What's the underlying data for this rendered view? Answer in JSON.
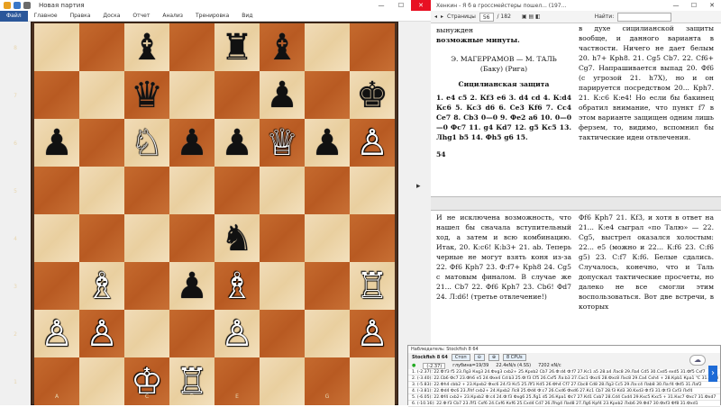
{
  "chess_app": {
    "title": "Новая партия",
    "menu": [
      "Файл",
      "Главное",
      "Правка",
      "Доска",
      "Отчет",
      "Анализ",
      "Тренировка",
      "Вид"
    ],
    "ranks": [
      "8",
      "7",
      "6",
      "5",
      "4",
      "3",
      "2",
      "1"
    ],
    "files": [
      "A",
      "B",
      "C",
      "D",
      "E",
      "F",
      "G",
      "H"
    ],
    "board": [
      [
        "",
        "",
        "bB",
        "",
        "bR",
        "bB",
        "",
        ""
      ],
      [
        "",
        "",
        "bQ",
        "",
        "",
        "bP",
        "",
        "bK"
      ],
      [
        "bP",
        "",
        "wN",
        "bP",
        "bP",
        "wQ",
        "bP",
        "wP"
      ],
      [
        "",
        "",
        "",
        "",
        "",
        "",
        "",
        ""
      ],
      [
        "",
        "",
        "",
        "",
        "bN",
        "",
        "",
        ""
      ],
      [
        "",
        "wB",
        "",
        "bP",
        "wB",
        "",
        "",
        "wR"
      ],
      [
        "wP",
        "wP",
        "",
        "",
        "wP",
        "",
        "",
        "wP"
      ],
      [
        "",
        "",
        "wK",
        "wR",
        "",
        "",
        "",
        ""
      ]
    ],
    "pieces": {
      "wK": "♔",
      "wQ": "♕",
      "wR": "♖",
      "wB": "♗",
      "wN": "♘",
      "wP": "♙",
      "bK": "♚",
      "bQ": "♛",
      "bR": "♜",
      "bB": "♝",
      "bN": "♞",
      "bP": "♟"
    }
  },
  "reader": {
    "title": "Хенкин - Я б в гроссмейстеры пошел... (197…",
    "toolbar": {
      "pages_label": "Страницы",
      "page_value": "56",
      "page_total": "/ 182",
      "search_label": "Найти:"
    },
    "top_left": {
      "line1": "вынужден",
      "line2": "возможные минуты.",
      "game_header": "Э. МАГЕРРАМОВ — М. ТАЛЬ",
      "game_cities": "(Баку)                    (Рига)",
      "opening": "Сицилианская защита",
      "moves": "1. e4 c5 2. Кf3 e6 3. d4 cd 4. К:d4 Кc6 5. Кc3 d6 6. Ce3 Кf6 7. Cc4 Ce7 8. Cb3 0—0 9. Фe2 a6 10. 0—0—0 Фc7 11. g4 Кd7 12. g5 Кc5 13. Лhg1 b5 14. Фh5 g6 15.",
      "page_number": "54"
    },
    "top_right": "в духе сицилианской защиты вообще, и данного варианта в частности. Ничего не дает белым 20. h7+ Крh8. 21. Cg5 Cb7. 22. Cf6+ Cg7. Напрашивается выпад 20. Фf6 (с угрозой 21. h7X), но и он парируется посредством 20... Крh7. 21. К:c6 К:e4! Но если бы бакинец обратил внимание, что пункт f7 в этом варианте защищен одним лишь ферзем, то, видимо, вспомнил бы тактические идеи отвлечения.",
    "bottom_left": "И не исключена возможность, что нашел бы сначала вступительный ход, а затем и всю комбинацию. Итак, 20. К:c6! К:b3+ 21. ab. Теперь черные не могут взять коня из-за 22. Фf6 Крh7 23. Ф:f7+ Крh8 24. Cg5 с матовым финалом. В случае же 21... Cb7 22. Фf6 Крh7 23. Cb6! Фd7 24. Л:d6! (третье отвлечение!)",
    "bottom_right": "Фf6 Крh7 21. Кf3, и хотя в ответ на 21... К:e4 сыграл «по Талю» — 22. Cg5, выстрел оказался холостым: 22... e5 (можно и 22... К:f6 23. C:f6 g5) 23. C:f7 К:f6. Белые сдались. Случалось, конечно, что и Таль допускал тактические просчеты, но далеко не все смогли этим воспользоваться. Вот две встречи, в которых"
  },
  "engine": {
    "title": "Наблюдатель: Stockfish 8 64",
    "engine_name": "Stockfish 8 64",
    "btn_start": "Стоп",
    "cpu": "8 CPUs",
    "eval": "(-2.37)",
    "depth": "глубина=19/39",
    "speed": "22.4кN/s (4.SS)",
    "nodes": "7202 кN/с",
    "lines": [
      "1. (-2.37): 22.Ф:f3 f5 23.Лg3 Кxg3 24.Фxg3 cxb2+ 25.Крxb2 Cb7 26.Ф:d4 Ф:f7 27.Кс1 a5 28.a4 Лаc8 29.Ла4 Cd5 30.Cxd5 exd5 31.Фf5 Cxf7",
      "2. (-3.40): 22.Cb6 Фc7 23.Фh6 e5 24.Фxe4 Cd:b3 25.Ф:f3 Cf5 26.Cxf5 Ла:b3 27.Cxc1 Фxc6 28.Фxc8 Лxc8 29.Ca4 Cxh4 + 28.Кpb1 Кpa1 ℃ 31.Кxc3",
      "3. (-5.83): 22.Фh4 cbb2 + 23.Кpxb2 Фxc6 24.f3 Кc5 25.Лf1 Кd5 26.Фh4 Cf7 27.Cbc8 Cd8 28.Лg3 Cc5 29.Ла:c4 Лab8 30.Ла:f4 Фd5 31.Лaf2",
      "4. (-3.81): 22.Фd4 Фc6 23.Лhf cxb2+ 24.Крxb2 Лс8 25.Фd4 Ф:c7 26.Cxd6 Фxd6 27.Кc1 Cb7 28.f3 Кd3 30.Kxd3 Ф:f3 31.Ф:f3 Cxf3 Лxf4",
      "5. (-6.05): 22.Фf4 cxb2+ 23.Крxb2 Ф:c4 24.Ф:f3 Фxg6 25.Лg1 d5 26.Крa1 Фc7 27.Кd1 Cxb7 28.Cd4 Cxd4 29.Кxc5 Кxc5 + 31.Кxc7 Фxc7 31.Фxd7",
      "6. (-10.16): 22.Ф:f3 Cb7 23.Лf1 Cxf6 24.Cxf6 Кxf6 25.Cxd4 Cd7 26.Лhg4 Лad8 27.Лg6 Крf4 23.Крxb2 Лxb6 29.Фd7 30.Фxf3 Фf8 31.Фxd1"
    ]
  }
}
